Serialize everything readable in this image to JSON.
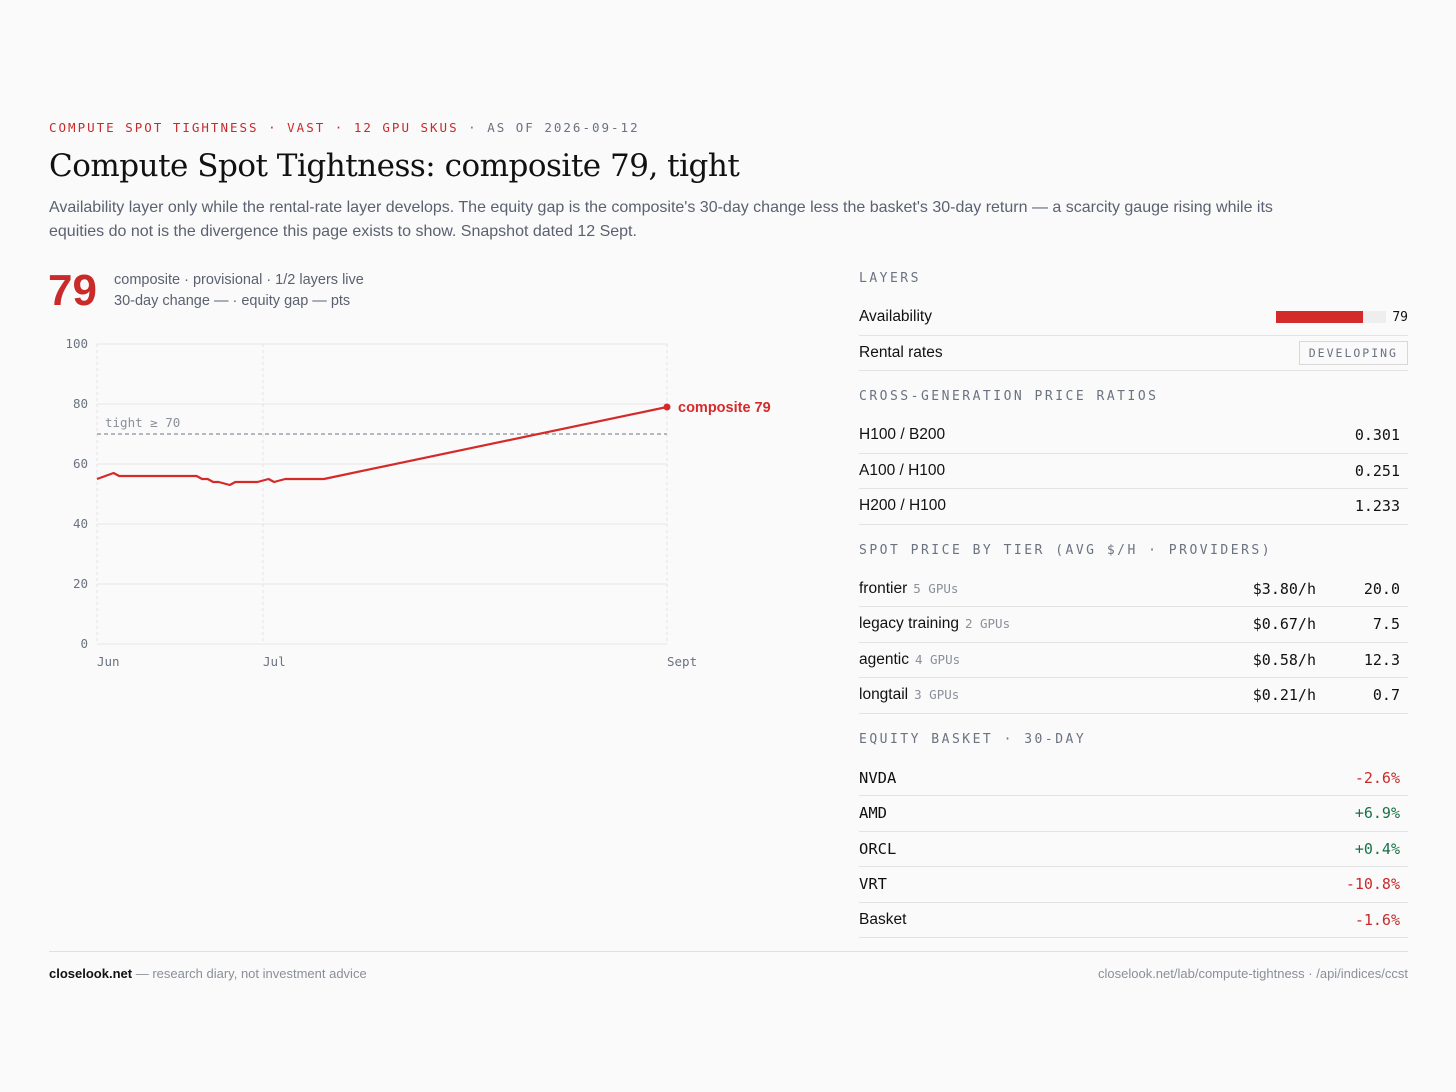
{
  "header": {
    "eyebrow_accent": "COMPUTE SPOT TIGHTNESS · VAST · 12 GPU SKUS",
    "eyebrow_rest": "· AS OF 2026-09-12",
    "title": "Compute Spot Tightness: composite 79, tight",
    "subtitle": "Availability layer only while the rental-rate layer develops. The equity gap is the composite's 30-day change less the basket's 30-day return — a scarcity gauge rising while its equities do not is the divergence this page exists to show. Snapshot dated 12 Sept."
  },
  "summary": {
    "value": "79",
    "line1": "composite · provisional · 1/2 layers live",
    "line2": "30-day change — · equity gap — pts"
  },
  "chart_data": {
    "type": "line",
    "x_axis": "dates",
    "x_range": [
      "2026-06-01",
      "2026-09-12"
    ],
    "x_ticks": [
      {
        "label": "Jun",
        "date": "2026-06-01"
      },
      {
        "label": "Jul",
        "date": "2026-07-01"
      },
      {
        "label": "Sept",
        "date": "2026-09-12"
      }
    ],
    "ylim": [
      0,
      100
    ],
    "y_ticks": [
      0,
      20,
      40,
      60,
      80,
      100
    ],
    "grid": true,
    "threshold": {
      "value": 70,
      "label": "tight ≥ 70"
    },
    "end_label": "composite 79",
    "series": [
      {
        "color": "#d42a2a",
        "points": [
          {
            "x": "2026-06-01",
            "y": 55
          },
          {
            "x": "2026-06-04",
            "y": 57
          },
          {
            "x": "2026-06-05",
            "y": 56
          },
          {
            "x": "2026-06-19",
            "y": 56
          },
          {
            "x": "2026-06-20",
            "y": 55
          },
          {
            "x": "2026-06-21",
            "y": 55
          },
          {
            "x": "2026-06-22",
            "y": 54
          },
          {
            "x": "2026-06-23",
            "y": 54
          },
          {
            "x": "2026-06-25",
            "y": 53
          },
          {
            "x": "2026-06-26",
            "y": 54
          },
          {
            "x": "2026-06-30",
            "y": 54
          },
          {
            "x": "2026-07-02",
            "y": 55
          },
          {
            "x": "2026-07-03",
            "y": 54
          },
          {
            "x": "2026-07-05",
            "y": 55
          },
          {
            "x": "2026-07-12",
            "y": 55
          },
          {
            "x": "2026-09-12",
            "y": 79
          }
        ]
      }
    ]
  },
  "layers": {
    "heading": "LAYERS",
    "items": [
      {
        "label": "Availability",
        "value": 79,
        "value_text": "79"
      },
      {
        "label": "Rental rates",
        "badge": "DEVELOPING"
      }
    ]
  },
  "ratios": {
    "heading": "CROSS-GENERATION PRICE RATIOS",
    "items": [
      {
        "label": "H100 / B200",
        "value": "0.301"
      },
      {
        "label": "A100 / H100",
        "value": "0.251"
      },
      {
        "label": "H200 / H100",
        "value": "1.233"
      }
    ]
  },
  "tiers": {
    "heading": "SPOT PRICE BY TIER (AVG $/H · PROVIDERS)",
    "items": [
      {
        "label": "frontier",
        "gpus": "5 GPUs",
        "price": "$3.80/h",
        "providers": "20.0"
      },
      {
        "label": "legacy training",
        "gpus": "2 GPUs",
        "price": "$0.67/h",
        "providers": "7.5"
      },
      {
        "label": "agentic",
        "gpus": "4 GPUs",
        "price": "$0.58/h",
        "providers": "12.3"
      },
      {
        "label": "longtail",
        "gpus": "3 GPUs",
        "price": "$0.21/h",
        "providers": "0.7"
      }
    ]
  },
  "equity": {
    "heading": "EQUITY BASKET · 30-DAY",
    "items": [
      {
        "ticker": "NVDA",
        "change": "-2.6%",
        "dir": "neg"
      },
      {
        "ticker": "AMD",
        "change": "+6.9%",
        "dir": "pos"
      },
      {
        "ticker": "ORCL",
        "change": "+0.4%",
        "dir": "pos"
      },
      {
        "ticker": "VRT",
        "change": "-10.8%",
        "dir": "neg"
      },
      {
        "ticker": "Basket",
        "change": "-1.6%",
        "dir": "neg",
        "plain": true
      }
    ]
  },
  "footer": {
    "brand": "closelook.net",
    "tagline": "— research diary, not investment advice",
    "links": "closelook.net/lab/compute-tightness · /api/indices/ccst"
  }
}
